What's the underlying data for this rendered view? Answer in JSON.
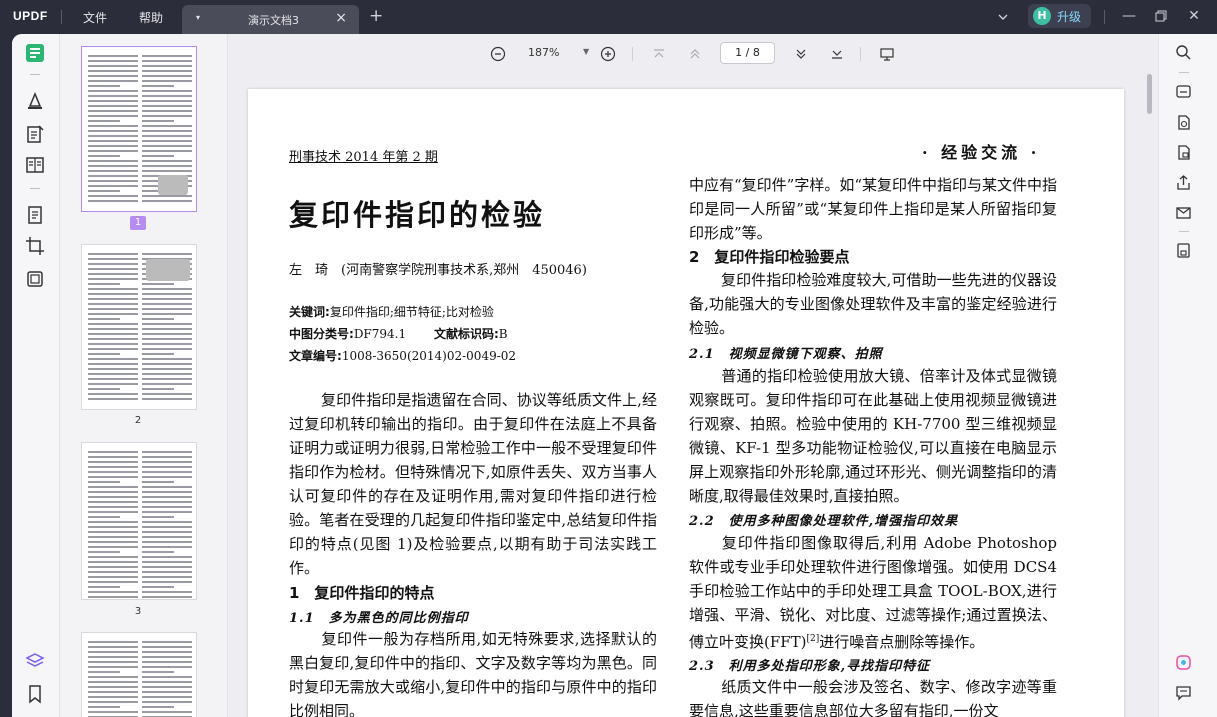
{
  "app": {
    "logo": "UPDF",
    "menu": [
      "文件",
      "帮助"
    ],
    "tab_name": "演示文档3",
    "upgrade_label": "升级",
    "upgrade_badge": "H"
  },
  "toolbar": {
    "zoom": "187%",
    "page_indicator": "1 / 8"
  },
  "thumbnails": [
    {
      "page": "1",
      "selected": true
    },
    {
      "page": "2",
      "selected": false
    },
    {
      "page": "3",
      "selected": false
    }
  ],
  "document": {
    "journal_left": "刑事技术 2014 年第 2 期",
    "journal_right": "· 经验交流 ·",
    "title": "复印件指印的检验",
    "author": "左　琦　(河南警察学院刑事技术系,郑州　450046)",
    "keywords_label": "关键词:",
    "keywords": "复印件指印;细节特征;比对检验",
    "clc_label": "中图分类号:",
    "clc": "DF794.1",
    "doccode_label": "文献标识码:",
    "doccode": "B",
    "article_label": "文章编号:",
    "article": "1008-3650(2014)02-0049-02",
    "left_para1": "复印件指印是指遗留在合同、协议等纸质文件上,经过复印机转印输出的指印。由于复印件在法庭上不具备证明力或证明力很弱,日常检验工作中一般不受理复印件指印作为检材。但特殊情况下,如原件丢失、双方当事人认可复印件的存在及证明作用,需对复印件指印进行检验。笔者在受理的几起复印件指印鉴定中,总结复印件指印的特点(见图 1)及检验要点,以期有助于司法实践工作。",
    "left_h1": "1　复印件指印的特点",
    "left_h2": "1.1　多为黑色的同比例指印",
    "left_para2": "复印件一般为存档所用,如无特殊要求,选择默认的黑白复印,复印件中的指印、文字及数字等均为黑色。同时复印无需放大或缩小,复印件中的指印与原件中的指印比例相同。",
    "right_para0": "中应有“复印件”字样。如“某复印件中指印与某文件中指印是同一人所留”或“某复印件上指印是某人所留指印复印形成”等。",
    "right_h1": "2　复印件指印检验要点",
    "right_para1": "复印件指印检验难度较大,可借助一些先进的仪器设备,功能强大的专业图像处理软件及丰富的鉴定经验进行检验。",
    "right_h2a": "2.1　视频显微镜下观察、拍照",
    "right_para2": "普通的指印检验使用放大镜、倍率计及体式显微镜观察既可。复印件指印可在此基础上使用视频显微镜进行观察、拍照。检验中使用的 KH-7700 型三维视频显微镜、KF-1 型多功能物证检验仪,可以直接在电脑显示屏上观察指印外形轮廓,通过环形光、侧光调整指印的清晰度,取得最佳效果时,直接拍照。",
    "right_h2b": "2.2　使用多种图像处理软件,增强指印效果",
    "right_para3": "复印件指印图像取得后,利用 Adobe Photoshop 软件或专业手印处理软件进行图像增强。如使用 DCS4 手印检验工作站中的手印处理工具盒 TOOL-BOX,进行增强、平滑、锐化、对比度、过滤等操作;通过置换法、傅立叶变换(FFT)",
    "right_para3_ref": "[2]",
    "right_para3_tail": "进行噪音点删除等操作。",
    "right_h2c": "2.3　利用多处指印形象,寻找指印特征",
    "right_para4": "纸质文件中一般会涉及签名、数字、修改字迹等重要信息,这些重要信息部位大多留有指印,一份文"
  }
}
